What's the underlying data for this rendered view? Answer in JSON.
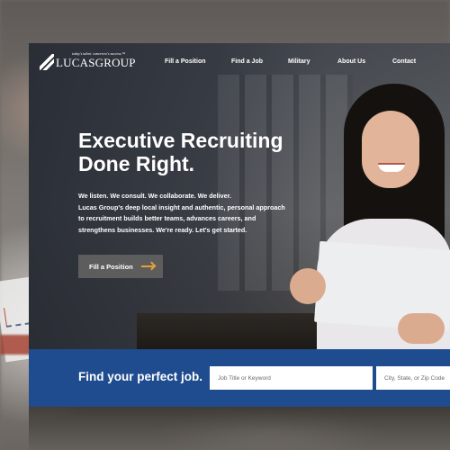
{
  "brand": {
    "tagline": "today's talent. tomorrow's success.™",
    "name": "LUCASGROUP"
  },
  "nav": {
    "items": [
      {
        "label": "Fill a Position"
      },
      {
        "label": "Find a Job"
      },
      {
        "label": "Military"
      },
      {
        "label": "About Us"
      },
      {
        "label": "Contact"
      }
    ]
  },
  "hero": {
    "headline_line1": "Executive Recruiting",
    "headline_line2": "Done Right.",
    "copy_lines": [
      "We listen. We consult. We collaborate. We deliver.",
      "Lucas Group's deep local insight and authentic, personal approach",
      "to recruitment builds better teams, advances careers, and",
      "strengthens businesses. We're ready. Let's get started."
    ],
    "cta_label": "Fill a Position"
  },
  "search": {
    "title": "Find your perfect job.",
    "keyword_placeholder": "Job Title or Keyword",
    "location_placeholder": "City, State, or Zip Code"
  },
  "colors": {
    "brand_blue": "#1f4c8f",
    "cta_arrow": "#e1a23a",
    "cta_bg": "#5d5d5d"
  },
  "icons": {
    "logo": "lucas-group-logo-mark",
    "cta": "arrow-right-icon"
  }
}
